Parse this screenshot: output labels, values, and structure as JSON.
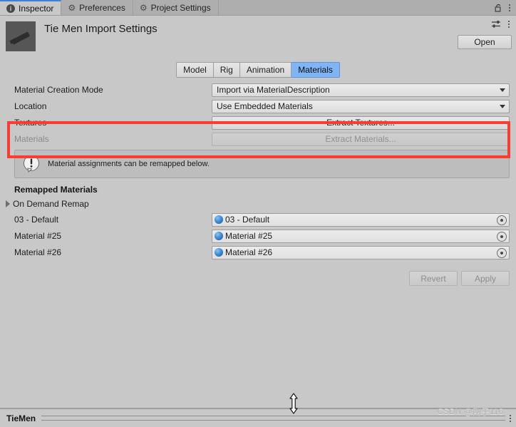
{
  "window": {
    "tabs": [
      {
        "label": "Inspector",
        "icon": "info-icon",
        "active": true
      },
      {
        "label": "Preferences",
        "icon": "gear-icon",
        "active": false
      },
      {
        "label": "Project Settings",
        "icon": "gear-icon",
        "active": false
      }
    ],
    "lock_icon": "lock-open-icon",
    "menu_icon": "kebab-menu-icon"
  },
  "header": {
    "title": "Tie Men Import Settings",
    "thumbnail": "asset-preview-thumbnail",
    "preset_icon": "preset-sliders-icon",
    "menu_icon": "kebab-menu-icon",
    "open_label": "Open"
  },
  "subtabs": [
    {
      "label": "Model",
      "active": false
    },
    {
      "label": "Rig",
      "active": false
    },
    {
      "label": "Animation",
      "active": false
    },
    {
      "label": "Materials",
      "active": true
    }
  ],
  "properties": {
    "material_creation_mode": {
      "label": "Material Creation Mode",
      "value": "Import via MaterialDescription"
    },
    "location": {
      "label": "Location",
      "value": "Use Embedded Materials"
    },
    "textures": {
      "label": "Textures",
      "button_label": "Extract Textures...",
      "disabled": false
    },
    "materials": {
      "label": "Materials",
      "button_label": "Extract Materials...",
      "disabled": true
    }
  },
  "helpbox": {
    "icon": "info-balloon-icon",
    "text": "Material assignments can be remapped below."
  },
  "remapped": {
    "section_title": "Remapped Materials",
    "foldout": {
      "label": "On Demand Remap",
      "expanded": false
    },
    "rows": [
      {
        "label": "03 - Default",
        "value": "03 - Default",
        "icon": "material-sphere-icon",
        "picker": "object-picker-icon"
      },
      {
        "label": "Material #25",
        "value": "Material #25",
        "icon": "material-sphere-icon",
        "picker": "object-picker-icon"
      },
      {
        "label": "Material #26",
        "value": "Material #26",
        "icon": "material-sphere-icon",
        "picker": "object-picker-icon"
      }
    ]
  },
  "footer": {
    "revert_label": "Revert",
    "apply_label": "Apply"
  },
  "statusbar": {
    "label": "TieMen",
    "menu_icon": "kebab-menu-icon",
    "resize_cursor": "vertical-resize-cursor"
  },
  "watermark": {
    "text": "CSDN @刚子116"
  },
  "annotation": {
    "highlight_color": "#fa3c32",
    "shape": "red-rectangle-highlight"
  },
  "colors": {
    "background": "#c8c8c8",
    "tabbar": "#aeaeae",
    "accent_blue": "#7fb4f5",
    "active_tab_underline": "#3f7fd4"
  }
}
